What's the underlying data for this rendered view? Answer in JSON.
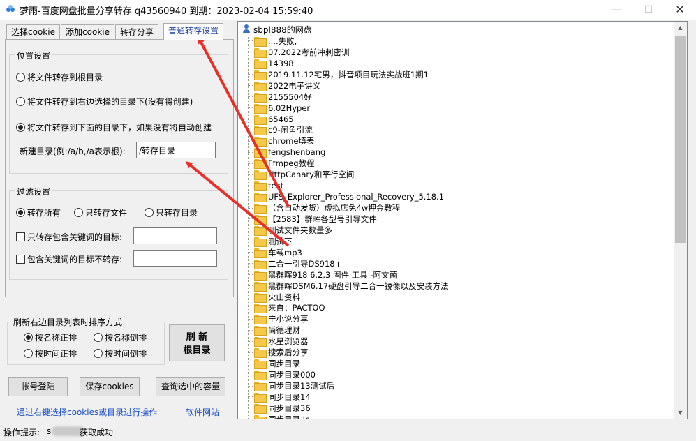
{
  "window": {
    "title": "梦雨-百度网盘批量分享转存 q43560940   到期：2023-02-04 15:59:40",
    "minimize": "—",
    "maximize": "☐",
    "close": "✕"
  },
  "tabs": [
    {
      "label": "选择cookie"
    },
    {
      "label": "添加cookie"
    },
    {
      "label": "转存分享"
    },
    {
      "label": "普通转存设置"
    }
  ],
  "location": {
    "group_title": "位置设置",
    "options": [
      {
        "label": "将文件转存到根目录",
        "selected": false
      },
      {
        "label": "将文件转存到右边选择的目录下(没有将创建)",
        "selected": false
      },
      {
        "label": "将文件转存到下面的目录下，如果没有将自动创建",
        "selected": true
      }
    ],
    "new_dir_label": "新建目录(例:/a/b,/a表示根):",
    "new_dir_value": "/转存目录"
  },
  "filter": {
    "group_title": "过滤设置",
    "options": [
      {
        "label": "转存所有",
        "selected": true
      },
      {
        "label": "只转存文件",
        "selected": false
      },
      {
        "label": "只转存目录",
        "selected": false
      }
    ],
    "include_label": "只转存包含关键词的目标:",
    "include_value": "",
    "exclude_label": "包含关键词的目标不转存:",
    "exclude_value": ""
  },
  "sort": {
    "group_title": "刷新右边目录列表时排序方式",
    "options": [
      {
        "label": "按名称正排",
        "selected": true
      },
      {
        "label": "按名称倒排",
        "selected": false
      },
      {
        "label": "按时间正排",
        "selected": false
      },
      {
        "label": "按时间倒排",
        "selected": false
      }
    ],
    "refresh_line1": "刷 新",
    "refresh_line2": "根目录"
  },
  "buttons": {
    "login": "帐号登陆",
    "save_cookies": "保存cookies",
    "query_capacity": "查询选中的容量"
  },
  "links": {
    "hint": "通过右键选择cookies或目录进行操作",
    "website": "软件网站"
  },
  "tree": {
    "root": "sbpl888的网盘",
    "items": [
      "....失败,",
      "07.2022考前冲刺密训",
      "14398",
      "2019.11.12宅男，抖音项目玩法实战班1期1",
      "2022电子讲义",
      "2155504好",
      "6.02Hyper",
      "65465",
      "c9-闲鱼引流",
      "chrome填表",
      "fengshenbang",
      "Ffmpeg教程",
      "HttpCanary和平行空间",
      "test",
      "UFS_Explorer_Professional_Recovery_5.18.1",
      "（含自动发货）虚拟店免4w押金教程",
      "【2583】群晖各型号引导文件",
      "测试文件夹数量多",
      "测试下",
      "车载mp3",
      "二合一引导DS918+",
      "黑群晖918 6.2.3 固件 工具 -阿文菌",
      "黑群晖DSM6.17硬盘引导二合一镜像以及安装方法",
      "火山资料",
      "来自：PACTOO",
      "宁小说分享",
      "尚德理财",
      "水星浏览器",
      "搜索后分享",
      "同步目录",
      "同步目录000",
      "同步目录13测试后",
      "同步目录14",
      "同步目录36",
      "同步目录 Jc"
    ]
  },
  "status": {
    "prefix": "操作提示:",
    "lead_char": "s",
    "message": "获取成功"
  },
  "colors": {
    "accent_tab": "#1a3c9e",
    "link": "#1a4ec7",
    "annotation_arrow": "#e8302a",
    "folder": "#f4c94a"
  }
}
